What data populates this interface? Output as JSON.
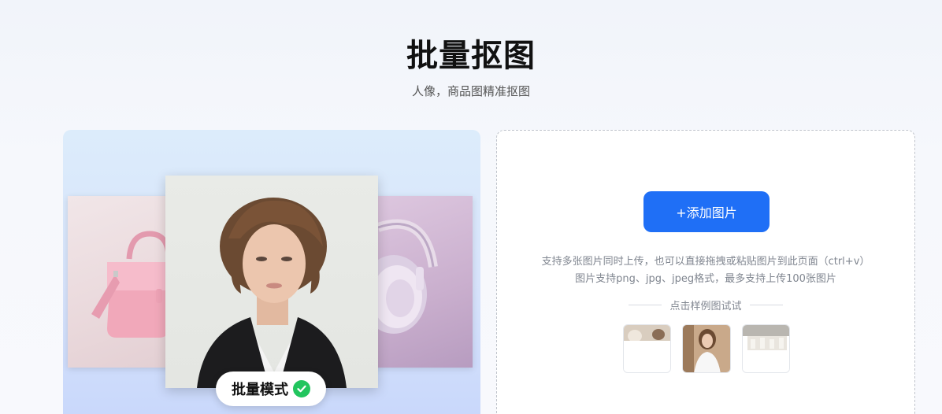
{
  "header": {
    "title": "批量抠图",
    "subtitle": "人像，商品图精准抠图"
  },
  "showcase": {
    "mode_label": "批量模式",
    "icons": {
      "badge": "check-circle-icon"
    },
    "colors": {
      "check": "#22c55e"
    }
  },
  "upload": {
    "add_button_label": "+添加图片",
    "hint_line1": "支持多张图片同时上传，也可以直接拖拽或粘贴图片到此页面（ctrl+v）",
    "hint_line2": "图片支持png、jpg、jpeg格式，最多支持上传100张图片",
    "sample_label": "点击样例图试试",
    "colors": {
      "accent": "#1f6ff6"
    }
  }
}
